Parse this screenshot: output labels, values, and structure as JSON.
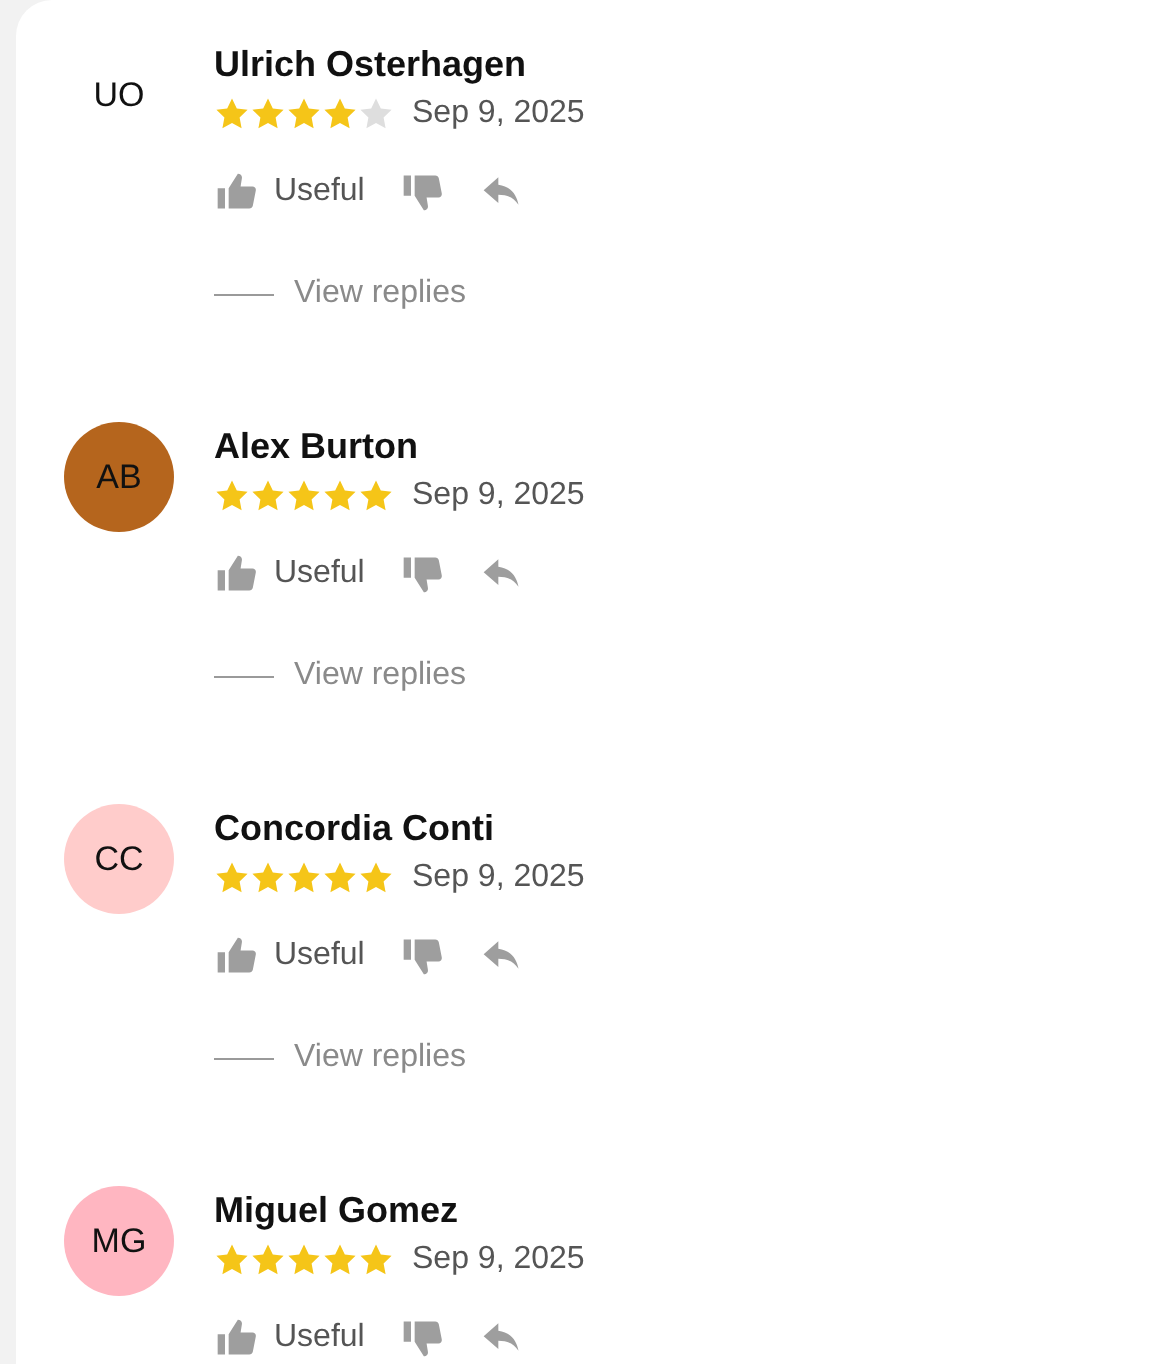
{
  "reviews": [
    {
      "initials": "UO",
      "name": "Ulrich Osterhagen",
      "stars": 4,
      "date": "Sep 9, 2025",
      "useful": "Useful",
      "view_replies": "View replies"
    },
    {
      "initials": "AB",
      "color": "#b5651d",
      "name": "Alex Burton",
      "stars": 5,
      "date": "Sep 9, 2025",
      "useful": "Useful",
      "view_replies": "View replies"
    },
    {
      "initials": "CC",
      "color": "#ffcccb",
      "name": "Concordia Conti",
      "stars": 5,
      "date": "Sep 9, 2025",
      "useful": "Useful",
      "view_replies": "View replies"
    },
    {
      "initials": "MG",
      "color": "#ffb6c1",
      "name": "Miguel Gomez",
      "stars": 5,
      "date": "Sep 9, 2025",
      "useful": "Useful"
    }
  ]
}
